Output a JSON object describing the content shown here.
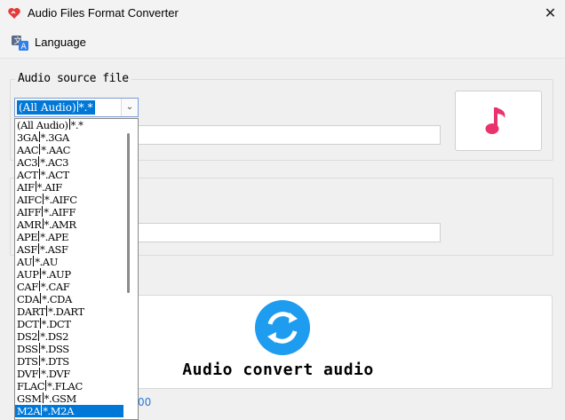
{
  "window": {
    "title": "Audio Files Format Converter",
    "close_glyph": "✕"
  },
  "menu": {
    "language_label": "Language"
  },
  "source_group": {
    "title": "Audio source file"
  },
  "combo": {
    "selected_name": "(All Audio)",
    "selected_ext": "*.*",
    "arrow_glyph": "⌄"
  },
  "dropdown": {
    "items": [
      {
        "name": "(All Audio)",
        "ext": "*.*"
      },
      {
        "name": "3GA",
        "ext": "*.3GA"
      },
      {
        "name": "AAC",
        "ext": "*.AAC"
      },
      {
        "name": "AC3",
        "ext": "*.AC3"
      },
      {
        "name": "ACT",
        "ext": "*.ACT"
      },
      {
        "name": "AIF",
        "ext": "*.AIF"
      },
      {
        "name": "AIFC",
        "ext": "*.AIFC"
      },
      {
        "name": "AIFF",
        "ext": "*.AIFF"
      },
      {
        "name": "AMR",
        "ext": "*.AMR"
      },
      {
        "name": "APE",
        "ext": "*.APE"
      },
      {
        "name": "ASF",
        "ext": "*.ASF"
      },
      {
        "name": "AU",
        "ext": "*.AU"
      },
      {
        "name": "AUP",
        "ext": "*.AUP"
      },
      {
        "name": "CAF",
        "ext": "*.CAF"
      },
      {
        "name": "CDA",
        "ext": "*.CDA"
      },
      {
        "name": "DART",
        "ext": "*.DART"
      },
      {
        "name": "DCT",
        "ext": "*.DCT"
      },
      {
        "name": "DS2",
        "ext": "*.DS2"
      },
      {
        "name": "DSS",
        "ext": "*.DSS"
      },
      {
        "name": "DTS",
        "ext": "*.DTS"
      },
      {
        "name": "DVF",
        "ext": "*.DVF"
      },
      {
        "name": "FLAC",
        "ext": "*.FLAC"
      },
      {
        "name": "GSM",
        "ext": "*.GSM"
      },
      {
        "name": "M2A",
        "ext": "*.M2A"
      }
    ],
    "highlighted_index": 23
  },
  "convert": {
    "label": "Audio convert audio"
  },
  "footer": {
    "link_fragment": "00"
  },
  "colors": {
    "accent": "#0078d7",
    "music": "#e8336c",
    "convert": "#1e9cf0"
  },
  "icons": [
    "app-heart-icon",
    "close-icon",
    "language-translate-icon",
    "chevron-down-icon",
    "music-note-icon",
    "convert-refresh-icon"
  ]
}
